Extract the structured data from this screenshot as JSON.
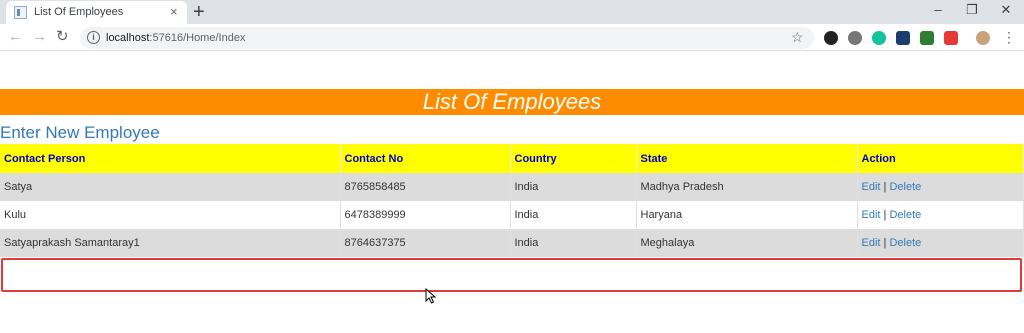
{
  "browser": {
    "tab_title": "List Of Employees",
    "tab_close": "×",
    "new_tab": "+",
    "url_host": "localhost",
    "url_rest": ":57616/Home/Index",
    "window_controls": [
      "–",
      "❐",
      "✕"
    ]
  },
  "page": {
    "banner_title": "List Of Employees",
    "new_employee_link": "Enter New Employee"
  },
  "table": {
    "headers": [
      "Contact Person",
      "Contact No",
      "Country",
      "State",
      "Action"
    ],
    "rows": [
      {
        "name": "Satya",
        "contact": "8765858485",
        "country": "India",
        "state": "Madhya Pradesh"
      },
      {
        "name": "Kulu",
        "contact": "6478389999",
        "country": "India",
        "state": "Haryana"
      },
      {
        "name": "Satyaprakash Samantaray1",
        "contact": "8764637375",
        "country": "India",
        "state": "Meghalaya"
      }
    ],
    "edit_label": "Edit",
    "delete_label": "Delete",
    "separator": "|"
  },
  "colors": {
    "banner": "#ff8c00",
    "header_row": "#ffff00",
    "header_text": "#0000cc",
    "link": "#337ab7",
    "highlight_border": "#e03a3a"
  }
}
